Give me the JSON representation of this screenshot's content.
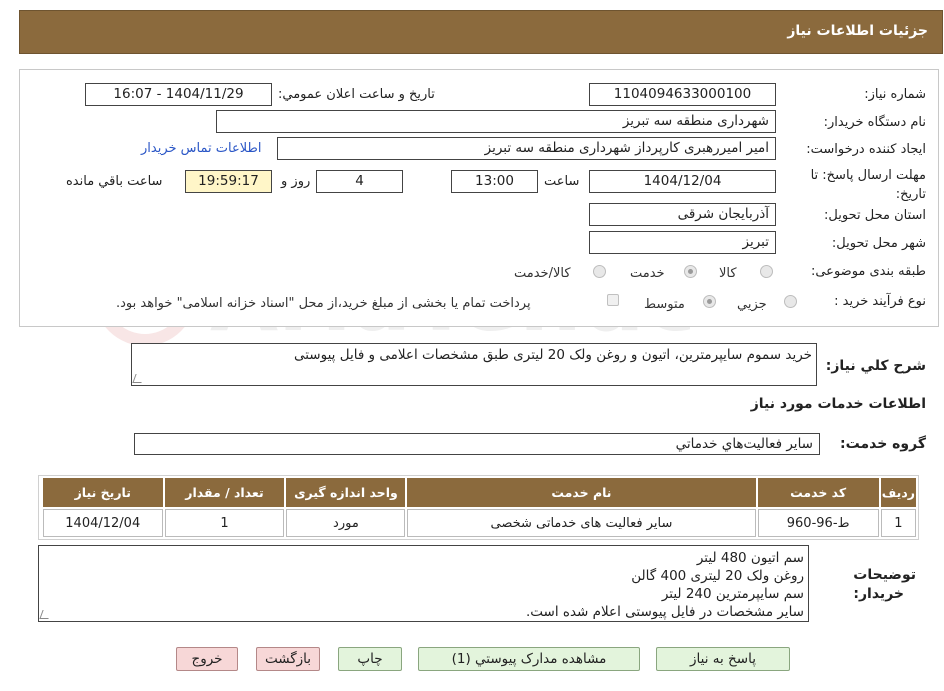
{
  "header": {
    "title": "جزئيات اطلاعات نياز"
  },
  "fields": {
    "need_number_label": "شماره نياز:",
    "need_number": "1104094633000100",
    "announce_label": "تاريخ و ساعت اعلان عمومي:",
    "announce_value": "1404/11/29 - 16:07",
    "buyer_org_label": "نام دستگاه خريدار:",
    "buyer_org": "شهرداری منطقه سه تبریز",
    "requester_label": "ايجاد کننده درخواست:",
    "requester": "امیر امیررهبری کارپرداز شهرداری منطقه سه تبریز",
    "contact_link": "اطلاعات تماس خريدار",
    "deadline_label": "مهلت ارسال پاسخ: تا تاريخ:",
    "deadline_date": "1404/12/04",
    "time_label": "ساعت",
    "deadline_time": "13:00",
    "days_value": "4",
    "days_label": "روز و",
    "remaining_time": "19:59:17",
    "remaining_label": "ساعت باقي مانده",
    "province_label": "استان محل تحويل:",
    "province": "آذربایجان شرقی",
    "city_label": "شهر محل تحويل:",
    "city": "تبریز",
    "category_label": "طبقه بندی موضوعی:",
    "category_options": [
      "کالا",
      "خدمت",
      "کالا/خدمت"
    ],
    "process_label": "نوع فرآيند خريد :",
    "process_options": [
      "جزيي",
      "متوسط"
    ],
    "payment_note": "پرداخت تمام يا بخشی از مبلغ خريد،از محل \"اسناد خزانه اسلامی\" خواهد بود."
  },
  "summary": {
    "label": "شرح کلي نياز:",
    "text": "خرید سموم سایپرمترین، اتیون و روغن ولک 20 لیتری طبق مشخصات اعلامی و فایل پیوستی"
  },
  "services": {
    "section_title": "اطلاعات خدمات مورد نياز",
    "group_label": "گروه خدمت:",
    "group_value": "ساير فعاليت‌هاي خدماتي"
  },
  "table": {
    "headers": [
      "رديف",
      "کد خدمت",
      "نام خدمت",
      "واحد اندازه گيری",
      "تعداد / مقدار",
      "تاريخ نياز"
    ],
    "rows": [
      [
        "1",
        "ط-96-960",
        "ساير فعاليت های خدماتی شخصی",
        "مورد",
        "1",
        "1404/12/04"
      ]
    ]
  },
  "notes": {
    "label_line1": "توضيحات",
    "label_line2": "خريدار:",
    "lines": [
      "سم اتیون 480 لیتر",
      "روغن ولک 20 لیتری 400 گالن",
      "سم سایپرمترین 240 لیتر",
      "سایر مشخصات در فایل پیوستی اعلام شده است."
    ]
  },
  "buttons": {
    "reply": "پاسخ به نياز",
    "attachments": "مشاهده مدارک پيوستي (1)",
    "print": "چاپ",
    "back": "بازگشت",
    "exit": "خروج"
  },
  "watermark": {
    "text": "AriaTender.neT"
  },
  "colors": {
    "header_bg": "#8b6a3d",
    "link": "#2a56c6",
    "highlight": "#fff6c8",
    "green_button": "#e3f4dc",
    "pink_button": "#f7d7d7"
  }
}
